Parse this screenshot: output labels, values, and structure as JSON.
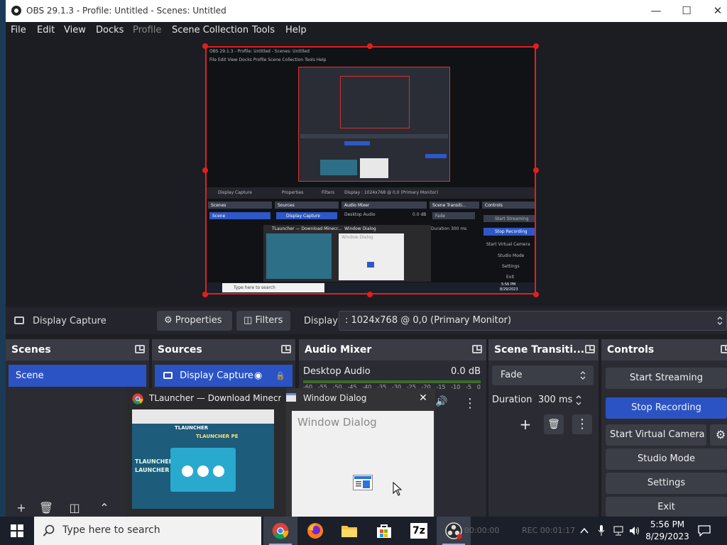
{
  "window": {
    "title": "OBS 29.1.3 - Profile: Untitled - Scenes: Untitled",
    "min_glyph": "—",
    "max_glyph": "☐",
    "close_glyph": "✕"
  },
  "menu": {
    "file": "File",
    "edit": "Edit",
    "view": "View",
    "docks": "Docks",
    "profile": "Profile",
    "scene_collection": "Scene Collection",
    "tools": "Tools",
    "help": "Help"
  },
  "source_toolbar": {
    "source_name": "Display Capture",
    "properties_label": "Properties",
    "filters_label": "Filters",
    "display_label": "Display",
    "display_value": ": 1024x768 @ 0,0 (Primary Monitor)",
    "gear_glyph": "⚙",
    "filter_glyph": "◫"
  },
  "scenes": {
    "title": "Scenes",
    "items": [
      "Scene"
    ]
  },
  "sources": {
    "title": "Sources",
    "items": [
      "Display Capture"
    ],
    "eye_glyph": "◉",
    "lock_glyph": "🔒"
  },
  "audio_mixer": {
    "title": "Audio Mixer",
    "channel_name": "Desktop Audio",
    "level": "0.0 dB",
    "scale": [
      "-60",
      "-55",
      "-50",
      "-45",
      "-40",
      "-35",
      "-30",
      "-25",
      "-20",
      "-15",
      "-10",
      "-5",
      "0"
    ],
    "speaker_glyph": "🔊",
    "menu_glyph": "⋮"
  },
  "transitions": {
    "title": "Scene Transiti...",
    "selected": "Fade",
    "duration_label": "Duration",
    "duration_value": "300 ms",
    "add_glyph": "+",
    "remove_glyph": "🗑",
    "menu_glyph": "⋮"
  },
  "controls": {
    "title": "Controls",
    "start_streaming": "Start Streaming",
    "stop_recording": "Stop Recording",
    "start_virtual_camera": "Start Virtual Camera",
    "studio_mode": "Studio Mode",
    "settings": "Settings",
    "exit": "Exit"
  },
  "thumbnails": {
    "chrome_title": "TLauncher — Download Minecr...",
    "dialog_title": "Window Dialog",
    "dialog_body_title": "Window Dialog",
    "tl_brand": "TLAUNCHER",
    "tl_brand2": "TLAUNCHER PE",
    "tl_left": "TLAUNCHER\nLAUNCHER",
    "close_glyph": "✕"
  },
  "mini_preview": {
    "menu_text": "File  Edit  View  Docks  Profile  Scene Collection  Tools  Help",
    "title_text": "OBS 29.1.3 - Profile: Untitled - Scenes: Untitled",
    "source_bar": "Display Capture",
    "properties": "Properties",
    "filters": "Filters",
    "display": "Display   : 1024x768 @ 0,0 (Primary Monitor)",
    "scenes": "Scenes",
    "sources": "Sources",
    "audio": "Audio Mixer",
    "trans": "Scene Transiti...",
    "controls": "Controls",
    "scene_item": "Scene",
    "source_item": "Display Capture",
    "desktop_audio": "Desktop Audio",
    "db": "0.0 dB",
    "fade": "Fade",
    "duration": "Duration   300 ms",
    "start_streaming": "Start Streaming",
    "stop_recording": "Stop Recording",
    "virtual_cam": "Start Virtual Camera",
    "studio_mode": "Studio Mode",
    "settings": "Settings",
    "exit": "Exit",
    "tl_title": "TLauncher — Download Minecr...",
    "wd_title": "Window Dialog",
    "wd_body": "Window Dialog",
    "search": "Type here to search",
    "time": "5:56 PM",
    "date": "8/29/2023"
  },
  "taskbar": {
    "search_placeholder": "Type here to search",
    "time": "5:56 PM",
    "date": "8/29/2023",
    "rec_status": "REC 00:01:17",
    "stream_status": "00:00:00",
    "app_7z": "7z"
  },
  "colors": {
    "accent_blue": "#2b53c4",
    "selection_red": "#e02020",
    "panel_bg": "#2a2b33",
    "header_bg": "#3a3b45"
  }
}
